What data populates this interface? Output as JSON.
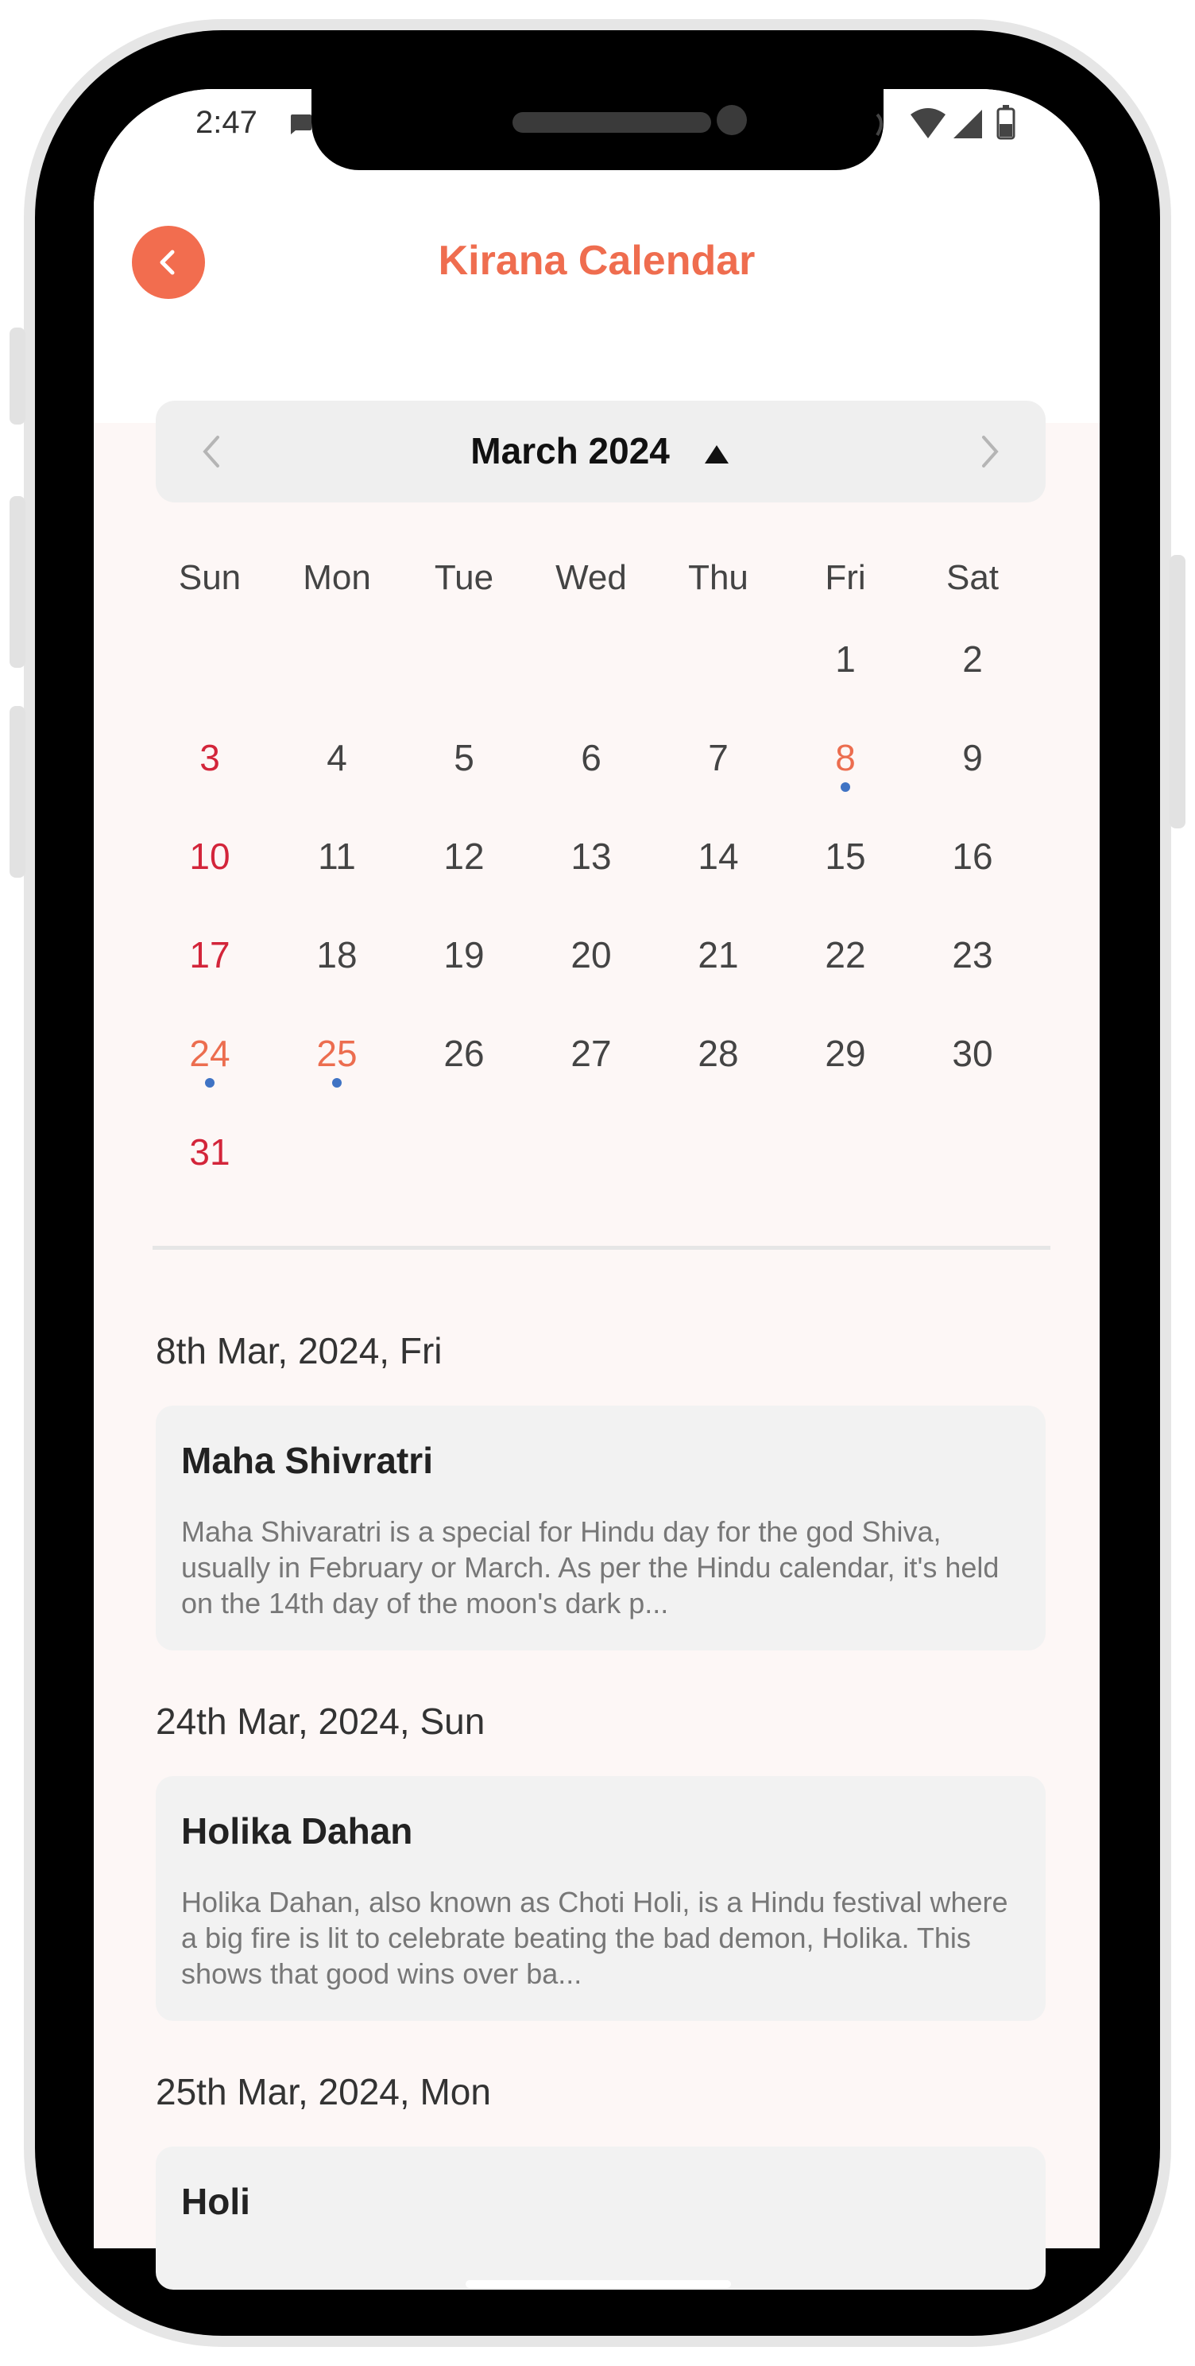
{
  "status_bar": {
    "time": "2:47"
  },
  "header": {
    "title": "Kirana Calendar",
    "back_icon": "chevron-left-icon"
  },
  "calendar": {
    "month_label": "March 2024",
    "weekdays": [
      "Sun",
      "Mon",
      "Tue",
      "Wed",
      "Thu",
      "Fri",
      "Sat"
    ],
    "days": [
      "1",
      "2",
      "3",
      "4",
      "5",
      "6",
      "7",
      "8",
      "9",
      "10",
      "11",
      "12",
      "13",
      "14",
      "15",
      "16",
      "17",
      "18",
      "19",
      "20",
      "21",
      "22",
      "23",
      "24",
      "25",
      "26",
      "27",
      "28",
      "29",
      "30",
      "31"
    ],
    "event_days": [
      "8",
      "24",
      "25"
    ],
    "colors": {
      "accent": "#ef6d4f",
      "sunday": "#d3253a",
      "event_dot": "#3f73c4"
    }
  },
  "events": [
    {
      "date": "8th Mar, 2024, Fri",
      "title": "Maha Shivratri",
      "description": "Maha Shivaratri is a special for Hindu day for the god Shiva, usually in February or March. As per the Hindu calendar, it's held on the 14th day of the moon's dark p..."
    },
    {
      "date": "24th Mar, 2024, Sun",
      "title": "Holika Dahan",
      "description": "Holika Dahan, also known as Choti Holi, is a Hindu festival where a big fire is lit to celebrate beating the bad demon, Holika. This shows that good wins over ba..."
    },
    {
      "date": "25th Mar, 2024, Mon",
      "title": "Holi",
      "description": ""
    }
  ]
}
